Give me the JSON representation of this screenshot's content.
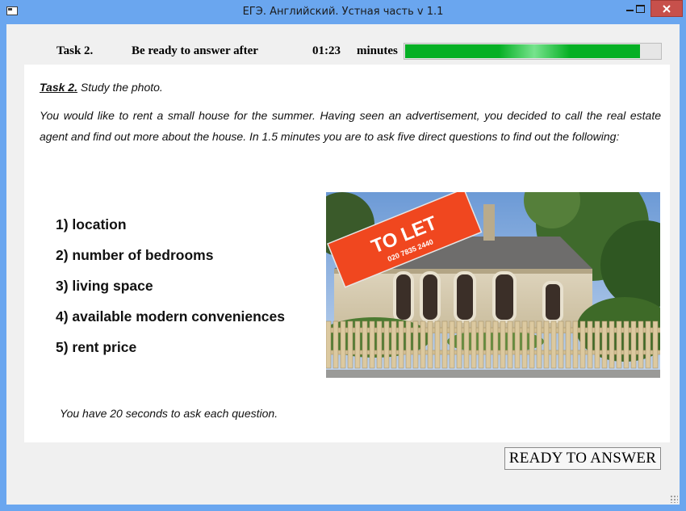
{
  "window": {
    "title": "ЕГЭ. Английский. Устная часть v 1.1"
  },
  "status": {
    "task_label": "Task 2.",
    "ready_label": "Be ready to answer after",
    "timer": "01:23",
    "minutes_label": "minutes",
    "progress_fraction": 0.92
  },
  "task": {
    "heading": "Task 2.",
    "heading_rest": " Study the photo.",
    "instruction": "You would like to rent a small house for the summer. Having seen an advertisement, you decided to call the real estate agent and find out more about the house. In 1.5 minutes you are to ask five direct questions to find out the following:",
    "questions": [
      "1) location",
      "2) number of bedrooms",
      "3) living space",
      "4) available modern conveniences",
      "5) rent price"
    ],
    "footer_note": "You have 20 seconds to ask each question."
  },
  "photo": {
    "sign_title": "TO LET",
    "sign_phone": "020 7835 2440"
  },
  "buttons": {
    "ready_to_answer": "READY TO ANSWER"
  },
  "colors": {
    "titlebar": "#6aa6ef",
    "progress": "#06b025",
    "close": "#c7504b",
    "sign": "#f0471f"
  }
}
